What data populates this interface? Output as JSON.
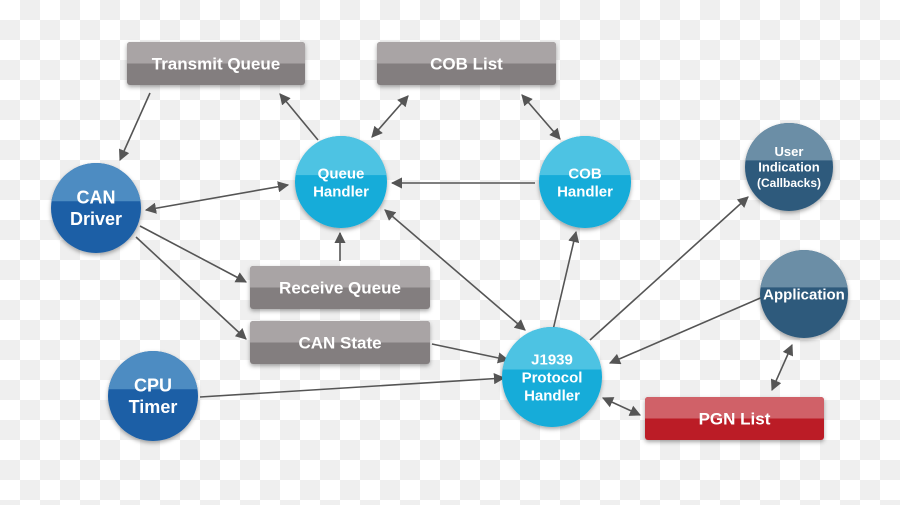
{
  "colors": {
    "can_blue": "#1a5fa6",
    "handler_cyan": "#12acd9",
    "app_slate": "#2e5a7c",
    "queue_gray": "#858081",
    "pgn_red": "#bb1c28",
    "arrow": "#555555"
  },
  "nodes": [
    {
      "id": "transmit-queue",
      "shape": "box",
      "style": "gray",
      "lines": [
        "Transmit Queue"
      ]
    },
    {
      "id": "cob-list",
      "shape": "box",
      "style": "gray",
      "lines": [
        "COB List"
      ]
    },
    {
      "id": "receive-queue",
      "shape": "box",
      "style": "gray",
      "lines": [
        "Receive Queue"
      ]
    },
    {
      "id": "can-state",
      "shape": "box",
      "style": "gray",
      "lines": [
        "CAN State"
      ]
    },
    {
      "id": "pgn-list",
      "shape": "box",
      "style": "red",
      "lines": [
        "PGN List"
      ]
    },
    {
      "id": "can-driver",
      "shape": "circle",
      "style": "blue",
      "lines": [
        "CAN",
        "Driver"
      ]
    },
    {
      "id": "cpu-timer",
      "shape": "circle",
      "style": "blue",
      "lines": [
        "CPU",
        "Timer"
      ]
    },
    {
      "id": "queue-handler",
      "shape": "circle",
      "style": "cyan",
      "lines": [
        "Queue",
        "Handler"
      ]
    },
    {
      "id": "cob-handler",
      "shape": "circle",
      "style": "cyan",
      "lines": [
        "COB",
        "Handler"
      ]
    },
    {
      "id": "j1939-protocol-handler",
      "shape": "circle",
      "style": "cyan",
      "lines": [
        "J1939",
        "Protocol",
        "Handler"
      ]
    },
    {
      "id": "user-indication",
      "shape": "circle",
      "style": "slate",
      "lines": [
        "User",
        "Indication",
        "(Callbacks)"
      ]
    },
    {
      "id": "application",
      "shape": "circle",
      "style": "slate",
      "lines": [
        "Application"
      ]
    }
  ],
  "edges": [
    {
      "from": "transmit-queue",
      "to": "can-driver",
      "direction": "forward"
    },
    {
      "from": "queue-handler",
      "to": "transmit-queue",
      "direction": "forward"
    },
    {
      "from": "queue-handler",
      "to": "cob-list",
      "direction": "both"
    },
    {
      "from": "cob-list",
      "to": "cob-handler",
      "direction": "both"
    },
    {
      "from": "cob-handler",
      "to": "queue-handler",
      "direction": "forward"
    },
    {
      "from": "can-driver",
      "to": "queue-handler",
      "direction": "both"
    },
    {
      "from": "can-driver",
      "to": "receive-queue",
      "direction": "forward"
    },
    {
      "from": "can-driver",
      "to": "can-state",
      "direction": "forward"
    },
    {
      "from": "receive-queue",
      "to": "queue-handler",
      "direction": "forward"
    },
    {
      "from": "can-state",
      "to": "j1939-protocol-handler",
      "direction": "forward"
    },
    {
      "from": "queue-handler",
      "to": "j1939-protocol-handler",
      "direction": "both"
    },
    {
      "from": "cpu-timer",
      "to": "j1939-protocol-handler",
      "direction": "forward"
    },
    {
      "from": "j1939-protocol-handler",
      "to": "cob-handler",
      "direction": "forward"
    },
    {
      "from": "j1939-protocol-handler",
      "to": "user-indication",
      "direction": "forward"
    },
    {
      "from": "application",
      "to": "j1939-protocol-handler",
      "direction": "forward"
    },
    {
      "from": "j1939-protocol-handler",
      "to": "pgn-list",
      "direction": "both"
    },
    {
      "from": "pgn-list",
      "to": "application",
      "direction": "both"
    }
  ]
}
